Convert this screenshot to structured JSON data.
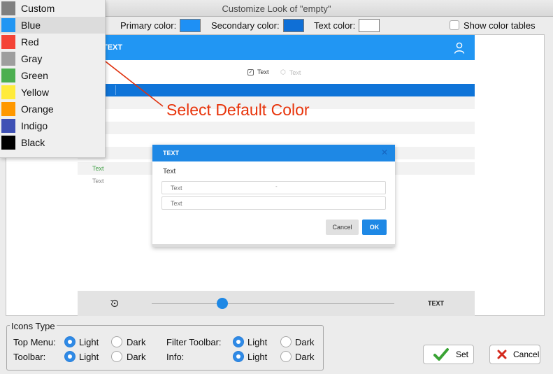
{
  "window": {
    "title": "Customize Look of \"empty\""
  },
  "toolbar": {
    "primary_label": "Primary color:",
    "secondary_label": "Secondary color:",
    "text_label": "Text color:",
    "show_tables_label": "Show color tables",
    "primary_color": "#1e90f5",
    "secondary_color": "#0f6fd6",
    "text_color": "#ffffff"
  },
  "menu": {
    "items": [
      {
        "label": "Custom",
        "color": "#808080"
      },
      {
        "label": "Blue",
        "color": "#2196f3"
      },
      {
        "label": "Red",
        "color": "#f44336"
      },
      {
        "label": "Gray",
        "color": "#9e9e9e"
      },
      {
        "label": "Green",
        "color": "#4caf50"
      },
      {
        "label": "Yellow",
        "color": "#ffeb3b"
      },
      {
        "label": "Orange",
        "color": "#ff9800"
      },
      {
        "label": "Indigo",
        "color": "#3f51b5"
      },
      {
        "label": "Black",
        "color": "#000000"
      }
    ]
  },
  "annotation": {
    "text": "Select Default Color",
    "color": "#e8340b"
  },
  "preview": {
    "header_title": "TEXT",
    "filter_item_1": "Text",
    "filter_item_2": "Text",
    "row_green": "Text",
    "row_gray": "Text",
    "bottom_label": "TEXT",
    "slider_value": 0.3,
    "dialog": {
      "title": "TEXT",
      "label": "Text",
      "field_1": "Text",
      "field_2": "Text",
      "cancel": "Cancel",
      "ok": "OK"
    }
  },
  "icons_type": {
    "title": "Icons Type",
    "top_menu_label": "Top Menu:",
    "toolbar_label": "Toolbar:",
    "filter_toolbar_label": "Filter Toolbar:",
    "info_label": "Info:",
    "light": "Light",
    "dark": "Dark"
  },
  "buttons": {
    "set": "Set",
    "cancel": "Cancel"
  }
}
